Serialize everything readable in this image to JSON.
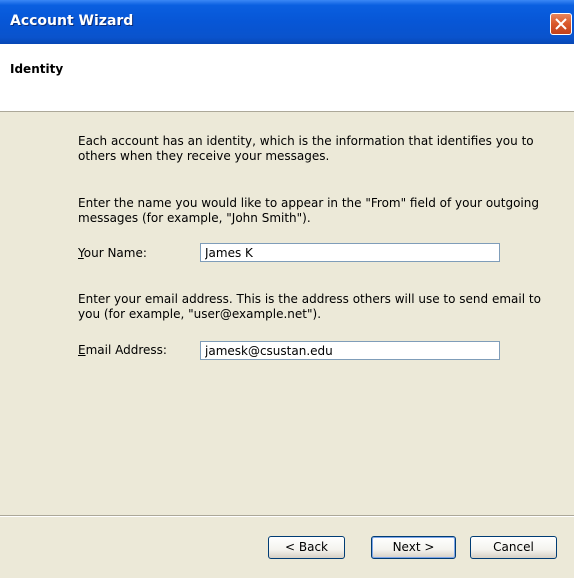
{
  "window": {
    "title": "Account Wizard"
  },
  "header": {
    "title": "Identity"
  },
  "body": {
    "intro": "Each account has an identity, which is the information that identifies you to others when they receive your messages.",
    "name_instructions": "Enter the name you would like to appear in the \"From\" field of your outgoing messages (for example, \"John Smith\").",
    "name_label_accesskey": "Y",
    "name_label_rest": "our Name:",
    "name_value": "James K",
    "email_instructions": "Enter your email address. This is the address others will use to send email to you (for example, \"user@example.net\").",
    "email_label_accesskey": "E",
    "email_label_rest": "mail Address:",
    "email_value": "jamesk@csustan.edu"
  },
  "buttons": {
    "back": "< Back",
    "next": "Next >",
    "cancel": "Cancel"
  }
}
